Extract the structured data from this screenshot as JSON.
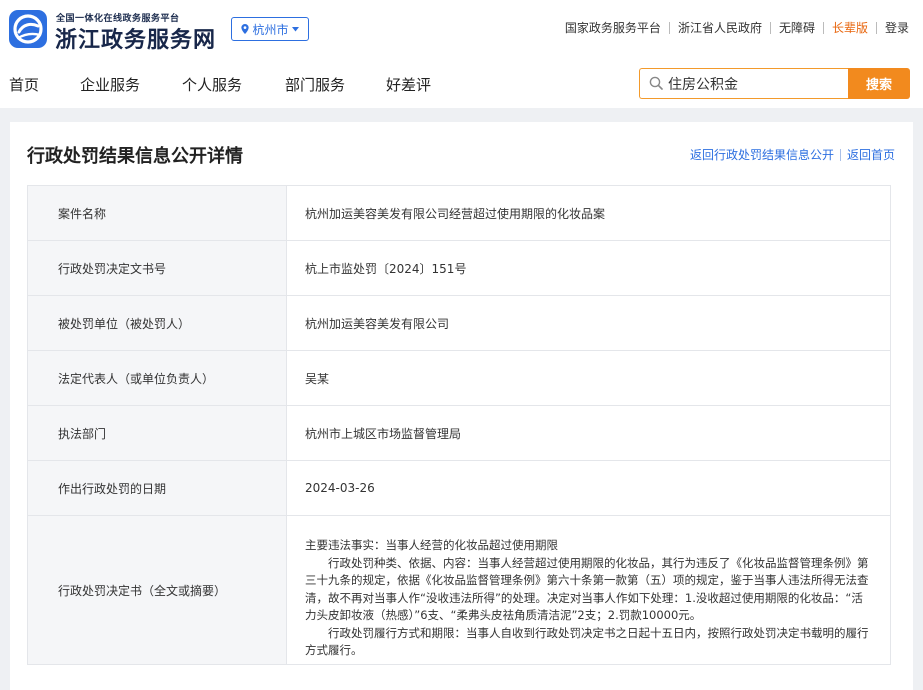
{
  "header": {
    "logo_subtitle": "全国一体化在线政务服务平台",
    "logo_title": "浙江政务服务网",
    "city_label": "杭州市",
    "links": [
      {
        "label": "国家政务服务平台"
      },
      {
        "label": "浙江省人民政府"
      },
      {
        "label": "无障碍"
      },
      {
        "label": "长辈版"
      },
      {
        "label": "登录"
      }
    ]
  },
  "nav": {
    "items": [
      {
        "label": "首页"
      },
      {
        "label": "企业服务"
      },
      {
        "label": "个人服务"
      },
      {
        "label": "部门服务"
      },
      {
        "label": "好差评"
      }
    ]
  },
  "search": {
    "value": "住房公积金",
    "button_label": "搜索"
  },
  "page": {
    "title": "行政处罚结果信息公开详情",
    "breadcrumb_back": "返回行政处罚结果信息公开",
    "breadcrumb_home": "返回首页"
  },
  "details": {
    "rows": [
      {
        "label": "案件名称",
        "value": "杭州加运美容美发有限公司经营超过使用期限的化妆品案"
      },
      {
        "label": "行政处罚决定文书号",
        "value": "杭上市监处罚〔2024〕151号"
      },
      {
        "label": "被处罚单位（被处罚人）",
        "value": "杭州加运美容美发有限公司"
      },
      {
        "label": "法定代表人（或单位负责人）",
        "value": "吴某"
      },
      {
        "label": "执法部门",
        "value": "杭州市上城区市场监督管理局"
      },
      {
        "label": "作出行政处罚的日期",
        "value": "2024-03-26"
      }
    ],
    "decision": {
      "label": "行政处罚决定书（全文或摘要）",
      "para1": "主要违法事实：当事人经营的化妆品超过使用期限",
      "para2": "行政处罚种类、依据、内容：当事人经营超过使用期限的化妆品，其行为违反了《化妆品监督管理条例》第三十九条的规定，依据《化妆品监督管理条例》第六十条第一款第（五）项的规定，鉴于当事人违法所得无法查清，故不再对当事人作“没收违法所得”的处理。决定对当事人作如下处理：1.没收超过使用期限的化妆品：“活力头皮卸妆液（热感）”6支、“柔弗头皮祛角质清洁泥”2支；2.罚款10000元。",
      "para3": "行政处罚履行方式和期限：当事人自收到行政处罚决定书之日起十五日内，按照行政处罚决定书载明的履行方式履行。"
    }
  }
}
